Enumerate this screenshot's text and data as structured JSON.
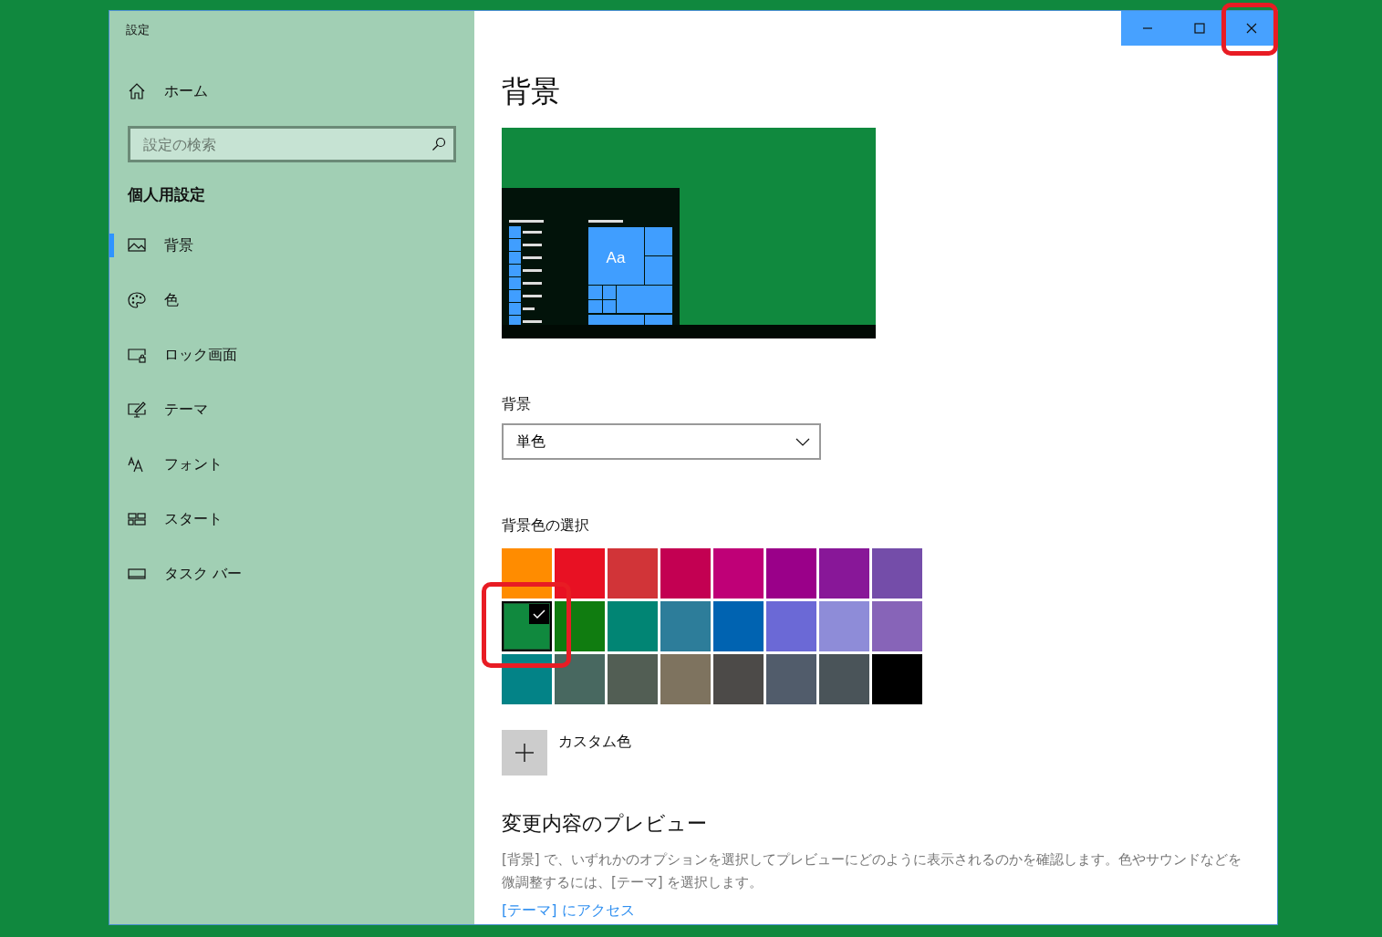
{
  "window": {
    "title": "設定",
    "controls": [
      {
        "kind": "minimize"
      },
      {
        "kind": "maximize"
      },
      {
        "kind": "close"
      }
    ]
  },
  "sidebar": {
    "home": "ホーム",
    "search": {
      "placeholder": "設定の検索"
    },
    "heading": "個人用設定",
    "items": [
      {
        "label": "背景",
        "selected": true
      },
      {
        "label": "色",
        "selected": false
      },
      {
        "label": "ロック画面",
        "selected": false
      },
      {
        "label": "テーマ",
        "selected": false
      },
      {
        "label": "フォント",
        "selected": false
      },
      {
        "label": "スタート",
        "selected": false
      },
      {
        "label": "タスク バー",
        "selected": false
      }
    ]
  },
  "main": {
    "title": "背景",
    "preview": {
      "tile_text": "Aa"
    },
    "background_label": "背景",
    "background_dropdown": {
      "value": "単色"
    },
    "color_label": "背景色の選択",
    "swatches": [
      {
        "color": "#ff8c00",
        "selected": false
      },
      {
        "color": "#e81123",
        "selected": false
      },
      {
        "color": "#d13438",
        "selected": false
      },
      {
        "color": "#c30052",
        "selected": false
      },
      {
        "color": "#bf0077",
        "selected": false
      },
      {
        "color": "#9a0089",
        "selected": false
      },
      {
        "color": "#881798",
        "selected": false
      },
      {
        "color": "#744da9",
        "selected": false
      },
      {
        "color": "#10893e",
        "selected": true
      },
      {
        "color": "#107c10",
        "selected": false
      },
      {
        "color": "#018574",
        "selected": false
      },
      {
        "color": "#2d7d9a",
        "selected": false
      },
      {
        "color": "#0063b1",
        "selected": false
      },
      {
        "color": "#6b69d6",
        "selected": false
      },
      {
        "color": "#8e8cd8",
        "selected": false
      },
      {
        "color": "#8764b8",
        "selected": false
      },
      {
        "color": "#038387",
        "selected": false
      },
      {
        "color": "#486860",
        "selected": false
      },
      {
        "color": "#525e54",
        "selected": false
      },
      {
        "color": "#7e735f",
        "selected": false
      },
      {
        "color": "#4c4a48",
        "selected": false
      },
      {
        "color": "#515c6b",
        "selected": false
      },
      {
        "color": "#4a5459",
        "selected": false
      },
      {
        "color": "#000000",
        "selected": false
      }
    ],
    "custom_color": "カスタム色",
    "preview_heading": "変更内容のプレビュー",
    "description": "[背景] で、いずれかのオプションを選択してプレビューにどのように表示されるのかを確認します。色やサウンドなどを微調整するには、[テーマ] を選択します。",
    "link": "[テーマ] にアクセス"
  }
}
